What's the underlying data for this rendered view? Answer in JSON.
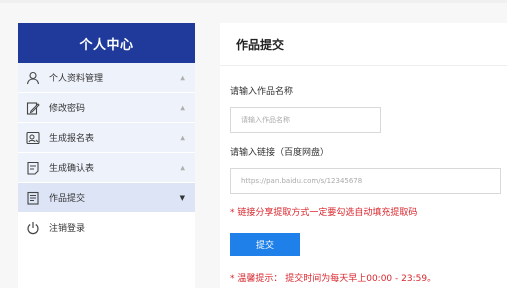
{
  "sidebar": {
    "title": "个人中心",
    "items": [
      {
        "label": "个人资料管理",
        "icon": "user-icon"
      },
      {
        "label": "修改密码",
        "icon": "edit-icon"
      },
      {
        "label": "生成报名表",
        "icon": "id-card-icon"
      },
      {
        "label": "生成确认表",
        "icon": "document-icon"
      },
      {
        "label": "作品提交",
        "icon": "submit-document-icon"
      },
      {
        "label": "注销登录",
        "icon": "power-icon"
      }
    ]
  },
  "main": {
    "title": "作品提交",
    "name_label": "请输入作品名称",
    "name_placeholder": "请输入作品名称",
    "link_label": "请输入链接（百度网盘）",
    "link_placeholder": "https://pan.baidu.com/s/12345678",
    "link_hint": "* 链接分享提取方式一定要勾选自动填充提取码",
    "submit_label": "提交",
    "notice": "* 温馨提示： 提交时间为每天早上00:00 - 23:59。"
  },
  "colors": {
    "header_blue": "#1f3a9b",
    "button_blue": "#1f80ea",
    "warning_red": "#d9262d"
  }
}
